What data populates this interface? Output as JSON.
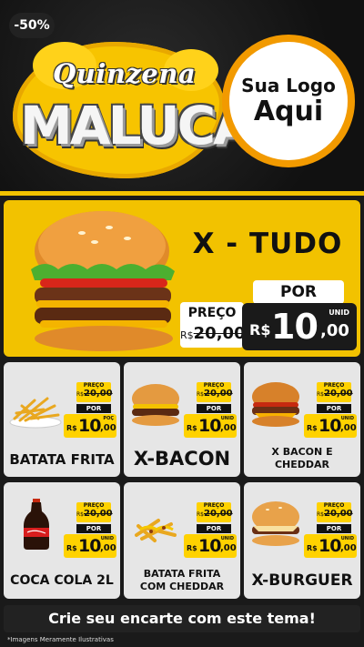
{
  "header": {
    "title_top": "Quinzena",
    "title_main": "MALUCA",
    "logo_line1": "Sua Logo",
    "logo_line2": "Aqui"
  },
  "featured": {
    "discount": "-50%",
    "name": "X - TUDO",
    "old_label": "PREÇO",
    "old_currency": "R$",
    "old_price": "20,00",
    "por_label": "POR",
    "unid_label": "UNID",
    "currency": "R$",
    "price_int": "10",
    "price_dec": ",00"
  },
  "products": [
    {
      "name": "BATATA FRITA",
      "old_label": "PREÇO",
      "old_currency": "R$",
      "old_price": "20,00",
      "por_label": "POR",
      "currency": "R$",
      "price_int": "10",
      "price_dec": ",00",
      "unit_label": "POÇ"
    },
    {
      "name": "X-BACON",
      "old_label": "PREÇO",
      "old_currency": "R$",
      "old_price": "20,00",
      "por_label": "POR",
      "currency": "R$",
      "price_int": "10",
      "price_dec": ",00",
      "unit_label": "UNID"
    },
    {
      "name": "X BACON E CHEDDAR",
      "old_label": "PREÇO",
      "old_currency": "R$",
      "old_price": "20,00",
      "por_label": "POR",
      "currency": "R$",
      "price_int": "10",
      "price_dec": ",00",
      "unit_label": "UNID"
    },
    {
      "name": "COCA COLA 2L",
      "old_label": "PREÇO",
      "old_currency": "R$",
      "old_price": "20,00",
      "por_label": "POR",
      "currency": "R$",
      "price_int": "10",
      "price_dec": ",00",
      "unit_label": "UNID"
    },
    {
      "name": "BATATA FRITA COM CHEDDAR",
      "old_label": "PREÇO",
      "old_currency": "R$",
      "old_price": "20,00",
      "por_label": "POR",
      "currency": "R$",
      "price_int": "10",
      "price_dec": ",00",
      "unit_label": "UNID"
    },
    {
      "name": "X-BURGUER",
      "old_label": "PREÇO",
      "old_currency": "R$",
      "old_price": "20,00",
      "por_label": "POR",
      "currency": "R$",
      "price_int": "10",
      "price_dec": ",00",
      "unit_label": "UNID"
    }
  ],
  "footer": {
    "cta": "Crie seu encarte com este tema!",
    "disclaimer": "*Imagens Meramente Ilustrativas"
  },
  "colors": {
    "accent_yellow": "#f2c200",
    "dark": "#1a1a1a",
    "card_bg": "#e6e6e6"
  },
  "icons": [
    "burger-image",
    "fries-image",
    "cola-bottle-image",
    "cheese-fries-image"
  ]
}
